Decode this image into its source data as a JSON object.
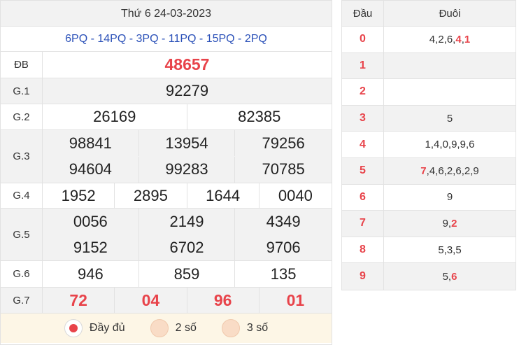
{
  "results": {
    "title": "Thứ 6 24-03-2023",
    "codes": "6PQ - 14PQ - 3PQ - 11PQ - 15PQ - 2PQ",
    "db": {
      "label": "ĐB",
      "values": [
        "48657"
      ]
    },
    "g1": {
      "label": "G.1",
      "values": [
        "92279"
      ]
    },
    "g2": {
      "label": "G.2",
      "values": [
        "26169",
        "82385"
      ]
    },
    "g3": {
      "label": "G.3",
      "values": [
        "98841",
        "13954",
        "79256",
        "94604",
        "99283",
        "70785"
      ]
    },
    "g4": {
      "label": "G.4",
      "values": [
        "1952",
        "2895",
        "1644",
        "0040"
      ]
    },
    "g5": {
      "label": "G.5",
      "values": [
        "0056",
        "2149",
        "4349",
        "9152",
        "6702",
        "9706"
      ]
    },
    "g6": {
      "label": "G.6",
      "values": [
        "946",
        "859",
        "135"
      ]
    },
    "g7": {
      "label": "G.7",
      "values": [
        "72",
        "04",
        "96",
        "01"
      ]
    }
  },
  "options": [
    {
      "label": "Đầy đủ",
      "checked": true
    },
    {
      "label": "2 số",
      "checked": false
    },
    {
      "label": "3 số",
      "checked": false
    }
  ],
  "loto": {
    "head_label": "Đầu",
    "tail_label": "Đuôi",
    "rows": [
      {
        "head": "0",
        "tails": [
          {
            "t": "4",
            "hl": false
          },
          {
            "t": "2",
            "hl": false
          },
          {
            "t": "6",
            "hl": false
          },
          {
            "t": "4",
            "hl": true
          },
          {
            "t": "1",
            "hl": true
          }
        ]
      },
      {
        "head": "1",
        "tails": []
      },
      {
        "head": "2",
        "tails": []
      },
      {
        "head": "3",
        "tails": [
          {
            "t": "5",
            "hl": false
          }
        ]
      },
      {
        "head": "4",
        "tails": [
          {
            "t": "1",
            "hl": false
          },
          {
            "t": "4",
            "hl": false
          },
          {
            "t": "0",
            "hl": false
          },
          {
            "t": "9",
            "hl": false
          },
          {
            "t": "9",
            "hl": false
          },
          {
            "t": "6",
            "hl": false
          }
        ]
      },
      {
        "head": "5",
        "tails": [
          {
            "t": "7",
            "hl": true
          },
          {
            "t": "4",
            "hl": false
          },
          {
            "t": "6",
            "hl": false
          },
          {
            "t": "2",
            "hl": false
          },
          {
            "t": "6",
            "hl": false
          },
          {
            "t": "2",
            "hl": false
          },
          {
            "t": "9",
            "hl": false
          }
        ]
      },
      {
        "head": "6",
        "tails": [
          {
            "t": "9",
            "hl": false
          }
        ]
      },
      {
        "head": "7",
        "tails": [
          {
            "t": "9",
            "hl": false
          },
          {
            "t": "2",
            "hl": true
          }
        ]
      },
      {
        "head": "8",
        "tails": [
          {
            "t": "5",
            "hl": false
          },
          {
            "t": "3",
            "hl": false
          },
          {
            "t": "5",
            "hl": false
          }
        ]
      },
      {
        "head": "9",
        "tails": [
          {
            "t": "5",
            "hl": false
          },
          {
            "t": "6",
            "hl": true
          }
        ]
      }
    ]
  },
  "colors": {
    "accent": "#e8434a",
    "codes": "#2a50b8",
    "row_gray": "#f2f2f2",
    "options_bg": "#fdf6e6"
  }
}
